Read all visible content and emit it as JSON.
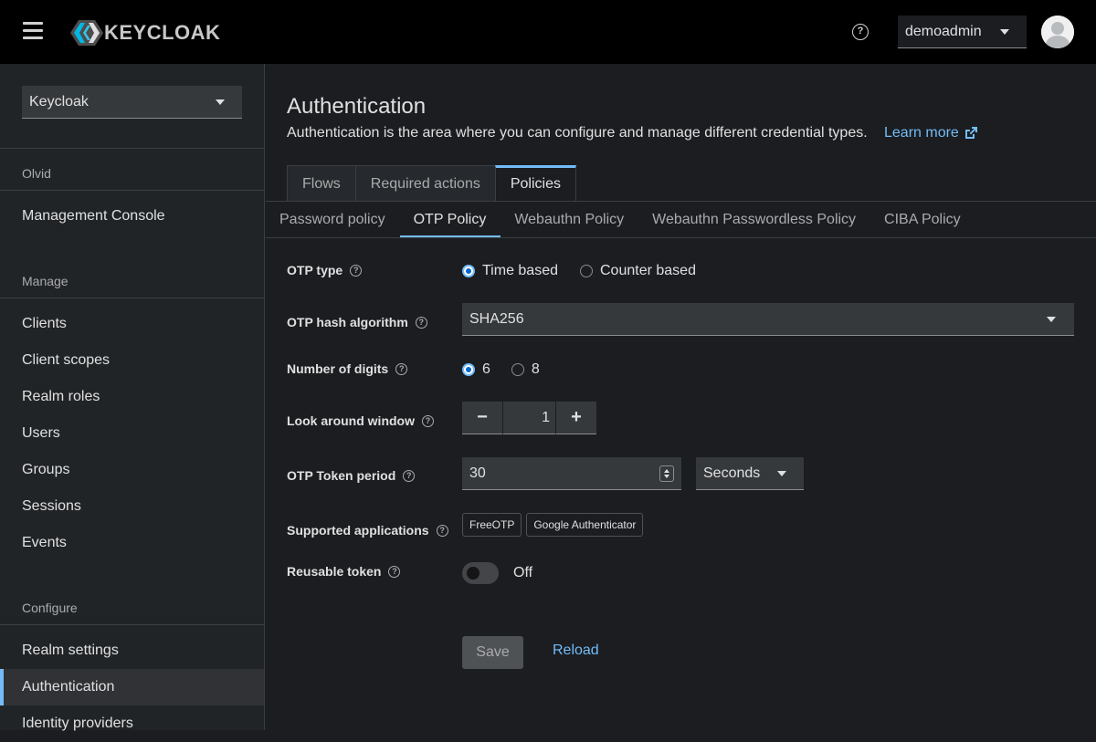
{
  "header": {
    "logo_text": "KEYCLOAK",
    "user": "demoadmin"
  },
  "sidebar": {
    "realm": "Keycloak",
    "realm_section": "Olvid",
    "console_item": "Management Console",
    "manage_section": "Manage",
    "manage_items": [
      "Clients",
      "Client scopes",
      "Realm roles",
      "Users",
      "Groups",
      "Sessions",
      "Events"
    ],
    "configure_section": "Configure",
    "configure_items": [
      "Realm settings",
      "Authentication",
      "Identity providers"
    ]
  },
  "page": {
    "title": "Authentication",
    "description": "Authentication is the area where you can configure and manage different credential types.",
    "learn_more": "Learn more"
  },
  "tabs": [
    "Flows",
    "Required actions",
    "Policies"
  ],
  "subtabs": [
    "Password policy",
    "OTP Policy",
    "Webauthn Policy",
    "Webauthn Passwordless Policy",
    "CIBA Policy"
  ],
  "form": {
    "otp_type_label": "OTP type",
    "otp_type_options": [
      "Time based",
      "Counter based"
    ],
    "hash_label": "OTP hash algorithm",
    "hash_value": "SHA256",
    "digits_label": "Number of digits",
    "digits_options": [
      "6",
      "8"
    ],
    "look_around_label": "Look around window",
    "look_around_value": "1",
    "minus": "−",
    "plus": "+",
    "period_label": "OTP Token period",
    "period_value": "30",
    "period_unit": "Seconds",
    "apps_label": "Supported applications",
    "apps": [
      "FreeOTP",
      "Google Authenticator"
    ],
    "reusable_label": "Reusable token",
    "reusable_state": "Off",
    "help": "?"
  },
  "actions": {
    "save": "Save",
    "reload": "Reload"
  },
  "colors": {
    "accent": "#73bcf7",
    "topbar": "#000000",
    "sidebar": "#212427",
    "background": "#1b1d21"
  }
}
